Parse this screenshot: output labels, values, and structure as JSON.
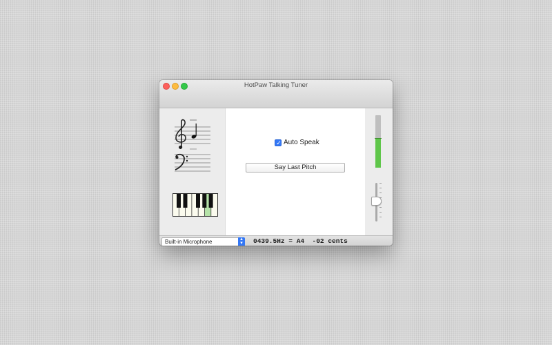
{
  "window": {
    "title": "HotPaw Talking Tuner"
  },
  "controls": {
    "auto_speak_label": "Auto Speak",
    "auto_speak_checked": true,
    "say_button_label": "Say Last Pitch"
  },
  "meters": {
    "level_fraction": 0.55,
    "volume_fraction": 0.6
  },
  "piano": {
    "highlighted_key": "A"
  },
  "bottom": {
    "input_source": "Built-in Microphone",
    "readout": "0439.5Hz = A4  -02 cents"
  },
  "colors": {
    "accent": "#3478f6",
    "meter": "#5fc64a",
    "highlight_key": "#b5e3a8"
  },
  "icons": {
    "treble_clef": "treble-clef-icon",
    "bass_clef": "bass-clef-icon",
    "note": "quarter-note-icon",
    "select_arrows": "chevron-updown-icon"
  }
}
